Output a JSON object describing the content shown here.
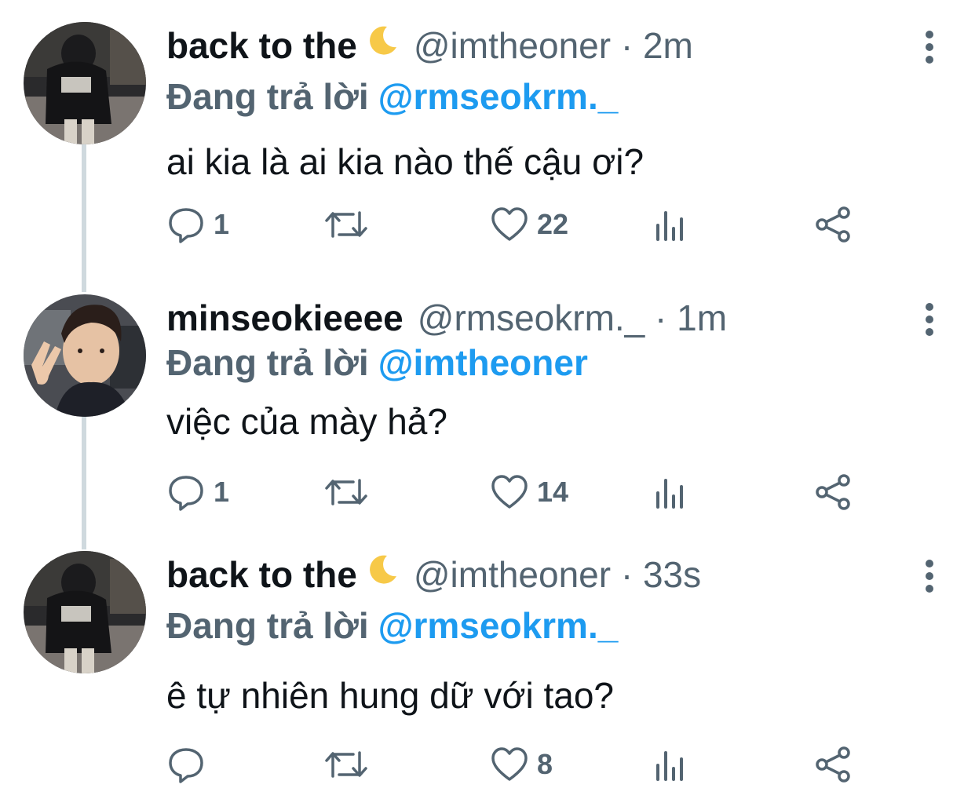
{
  "tweets": [
    {
      "name": "back to the",
      "handle": "@imtheoner",
      "dot": "·",
      "time": "2m",
      "reply_prefix": "Đang trả lời",
      "reply_handle": "@rmseokrm._",
      "text": "ai kia là ai kia nào thế cậu ơi?",
      "reply_count": "1",
      "like_count": "22",
      "avatar": "night-outdoor-hoodie-photo",
      "name_emoji": "crescent-moon-icon"
    },
    {
      "name": "minseokieeee",
      "handle": "@rmseokrm._",
      "dot": "·",
      "time": "1m",
      "reply_prefix": "Đang trả lời",
      "reply_handle": "@imtheoner",
      "text": "việc của mày hả?",
      "reply_count": "1",
      "like_count": "14",
      "avatar": "selfie-peace-sign-photo"
    },
    {
      "name": "back to the",
      "handle": "@imtheoner",
      "dot": "·",
      "time": "33s",
      "reply_prefix": "Đang trả lời",
      "reply_handle": "@rmseokrm._",
      "text": "ê tự nhiên hung dữ với tao?",
      "reply_count": "",
      "like_count": "8",
      "avatar": "night-outdoor-hoodie-photo",
      "name_emoji": "crescent-moon-icon"
    }
  ],
  "icons": {
    "reply": "reply-icon",
    "retweet": "retweet-icon",
    "like": "heart-icon",
    "views": "views-chart-icon",
    "share": "share-icon",
    "more": "more-vertical-icon"
  },
  "colors": {
    "text": "#0f1419",
    "secondary": "#536471",
    "link": "#1d9bf0",
    "thread_line": "#cfd9de"
  }
}
